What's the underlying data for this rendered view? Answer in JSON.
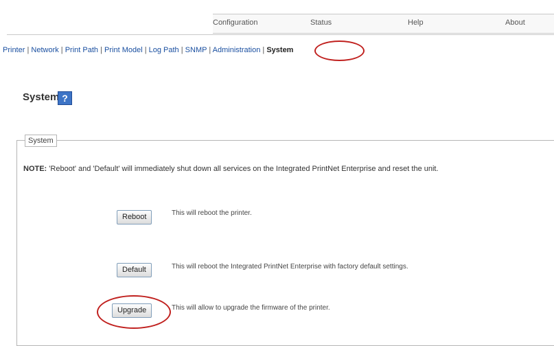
{
  "top_nav": [
    "Configuration",
    "Status",
    "Help",
    "About"
  ],
  "sub_nav": {
    "items": [
      "Printer",
      "Network",
      "Print Path",
      "Print Model",
      "Log Path",
      "SNMP",
      "Administration"
    ],
    "active": "System",
    "separator": "|"
  },
  "page": {
    "title": "System",
    "help_icon_glyph": "?"
  },
  "section": {
    "legend": "System",
    "note_label": "NOTE:",
    "note_text": "'Reboot' and 'Default' will immediately shut down all services on the Integrated PrintNet Enterprise and reset the unit."
  },
  "actions": {
    "reboot": {
      "label": "Reboot",
      "desc": "This will reboot the printer."
    },
    "default": {
      "label": "Default",
      "desc": "This will reboot the Integrated PrintNet Enterprise with factory default settings."
    },
    "upgrade": {
      "label": "Upgrade",
      "desc": "This will allow to upgrade the firmware of the printer."
    }
  },
  "colors": {
    "highlight_oval": "#c0201e",
    "link": "#1a4fa0",
    "help_icon": "#3d74c6"
  }
}
